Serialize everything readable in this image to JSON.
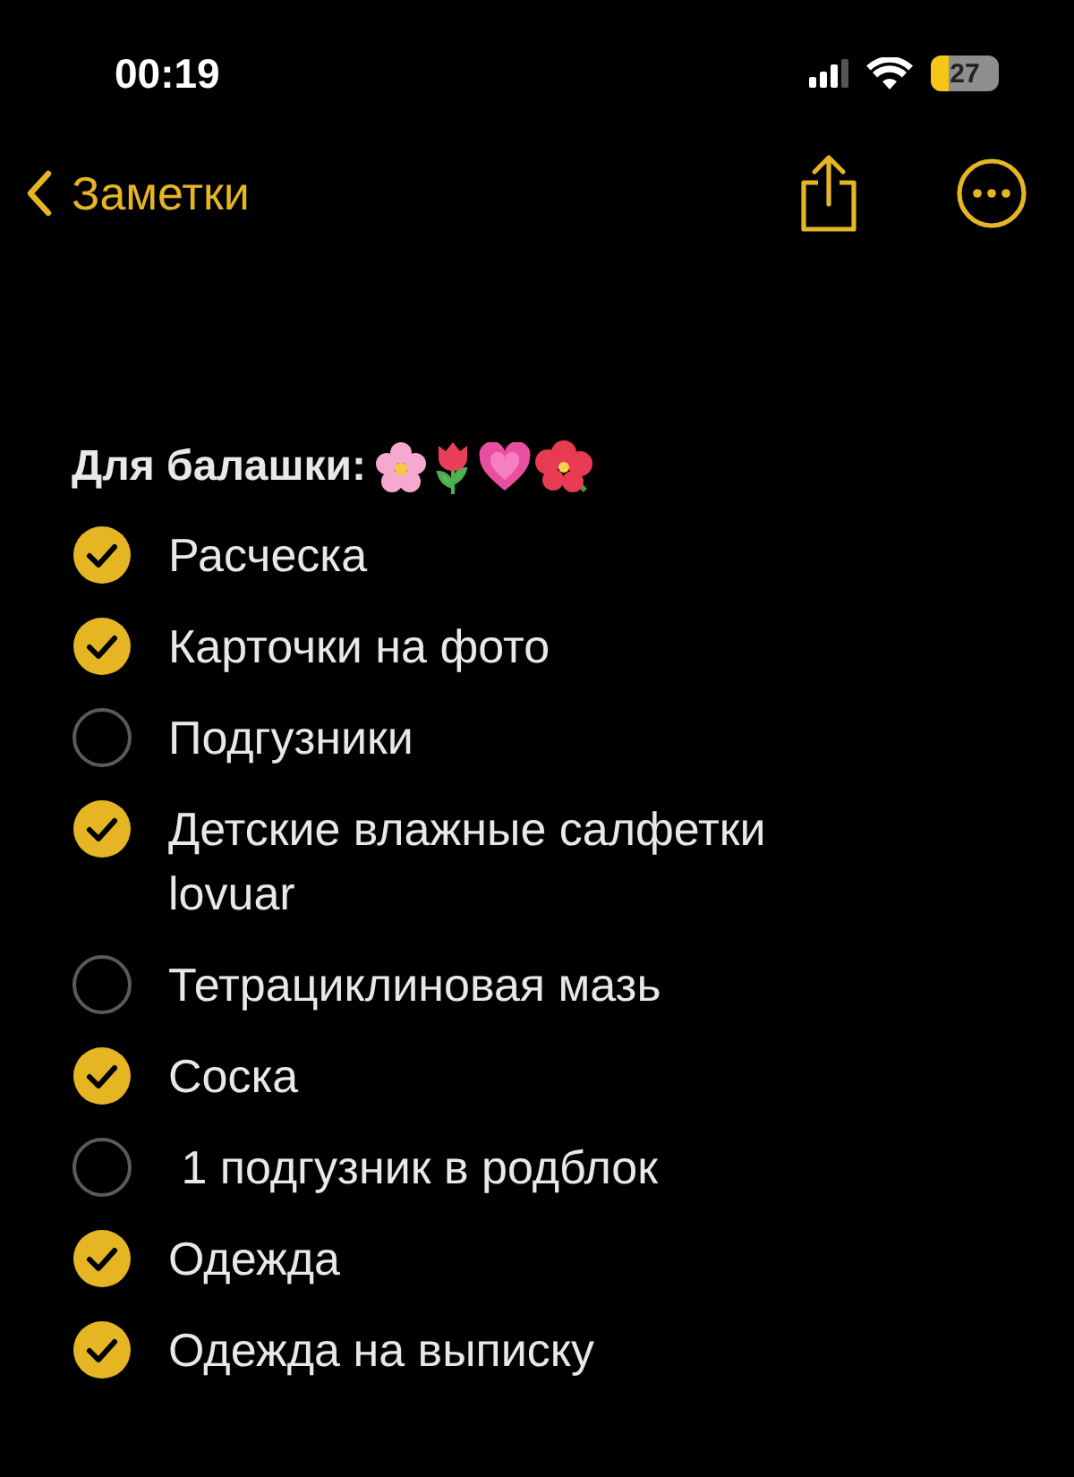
{
  "status_bar": {
    "time": "00:19",
    "battery": "27"
  },
  "nav": {
    "back": "Заметки"
  },
  "note": {
    "title": "Для балашки:",
    "items": [
      {
        "text": "Расческа",
        "checked": true
      },
      {
        "text": "Карточки на фото",
        "checked": true
      },
      {
        "text": "Подгузники",
        "checked": false
      },
      {
        "text": "Детские влажные салфетки lovuar",
        "checked": true
      },
      {
        "text": "Тетрациклиновая мазь",
        "checked": false
      },
      {
        "text": "Соска",
        "checked": true
      },
      {
        "text": " 1 подгузник в родблок",
        "checked": false
      },
      {
        "text": "Одежда",
        "checked": true
      },
      {
        "text": "Одежда на выписку",
        "checked": true
      }
    ]
  }
}
